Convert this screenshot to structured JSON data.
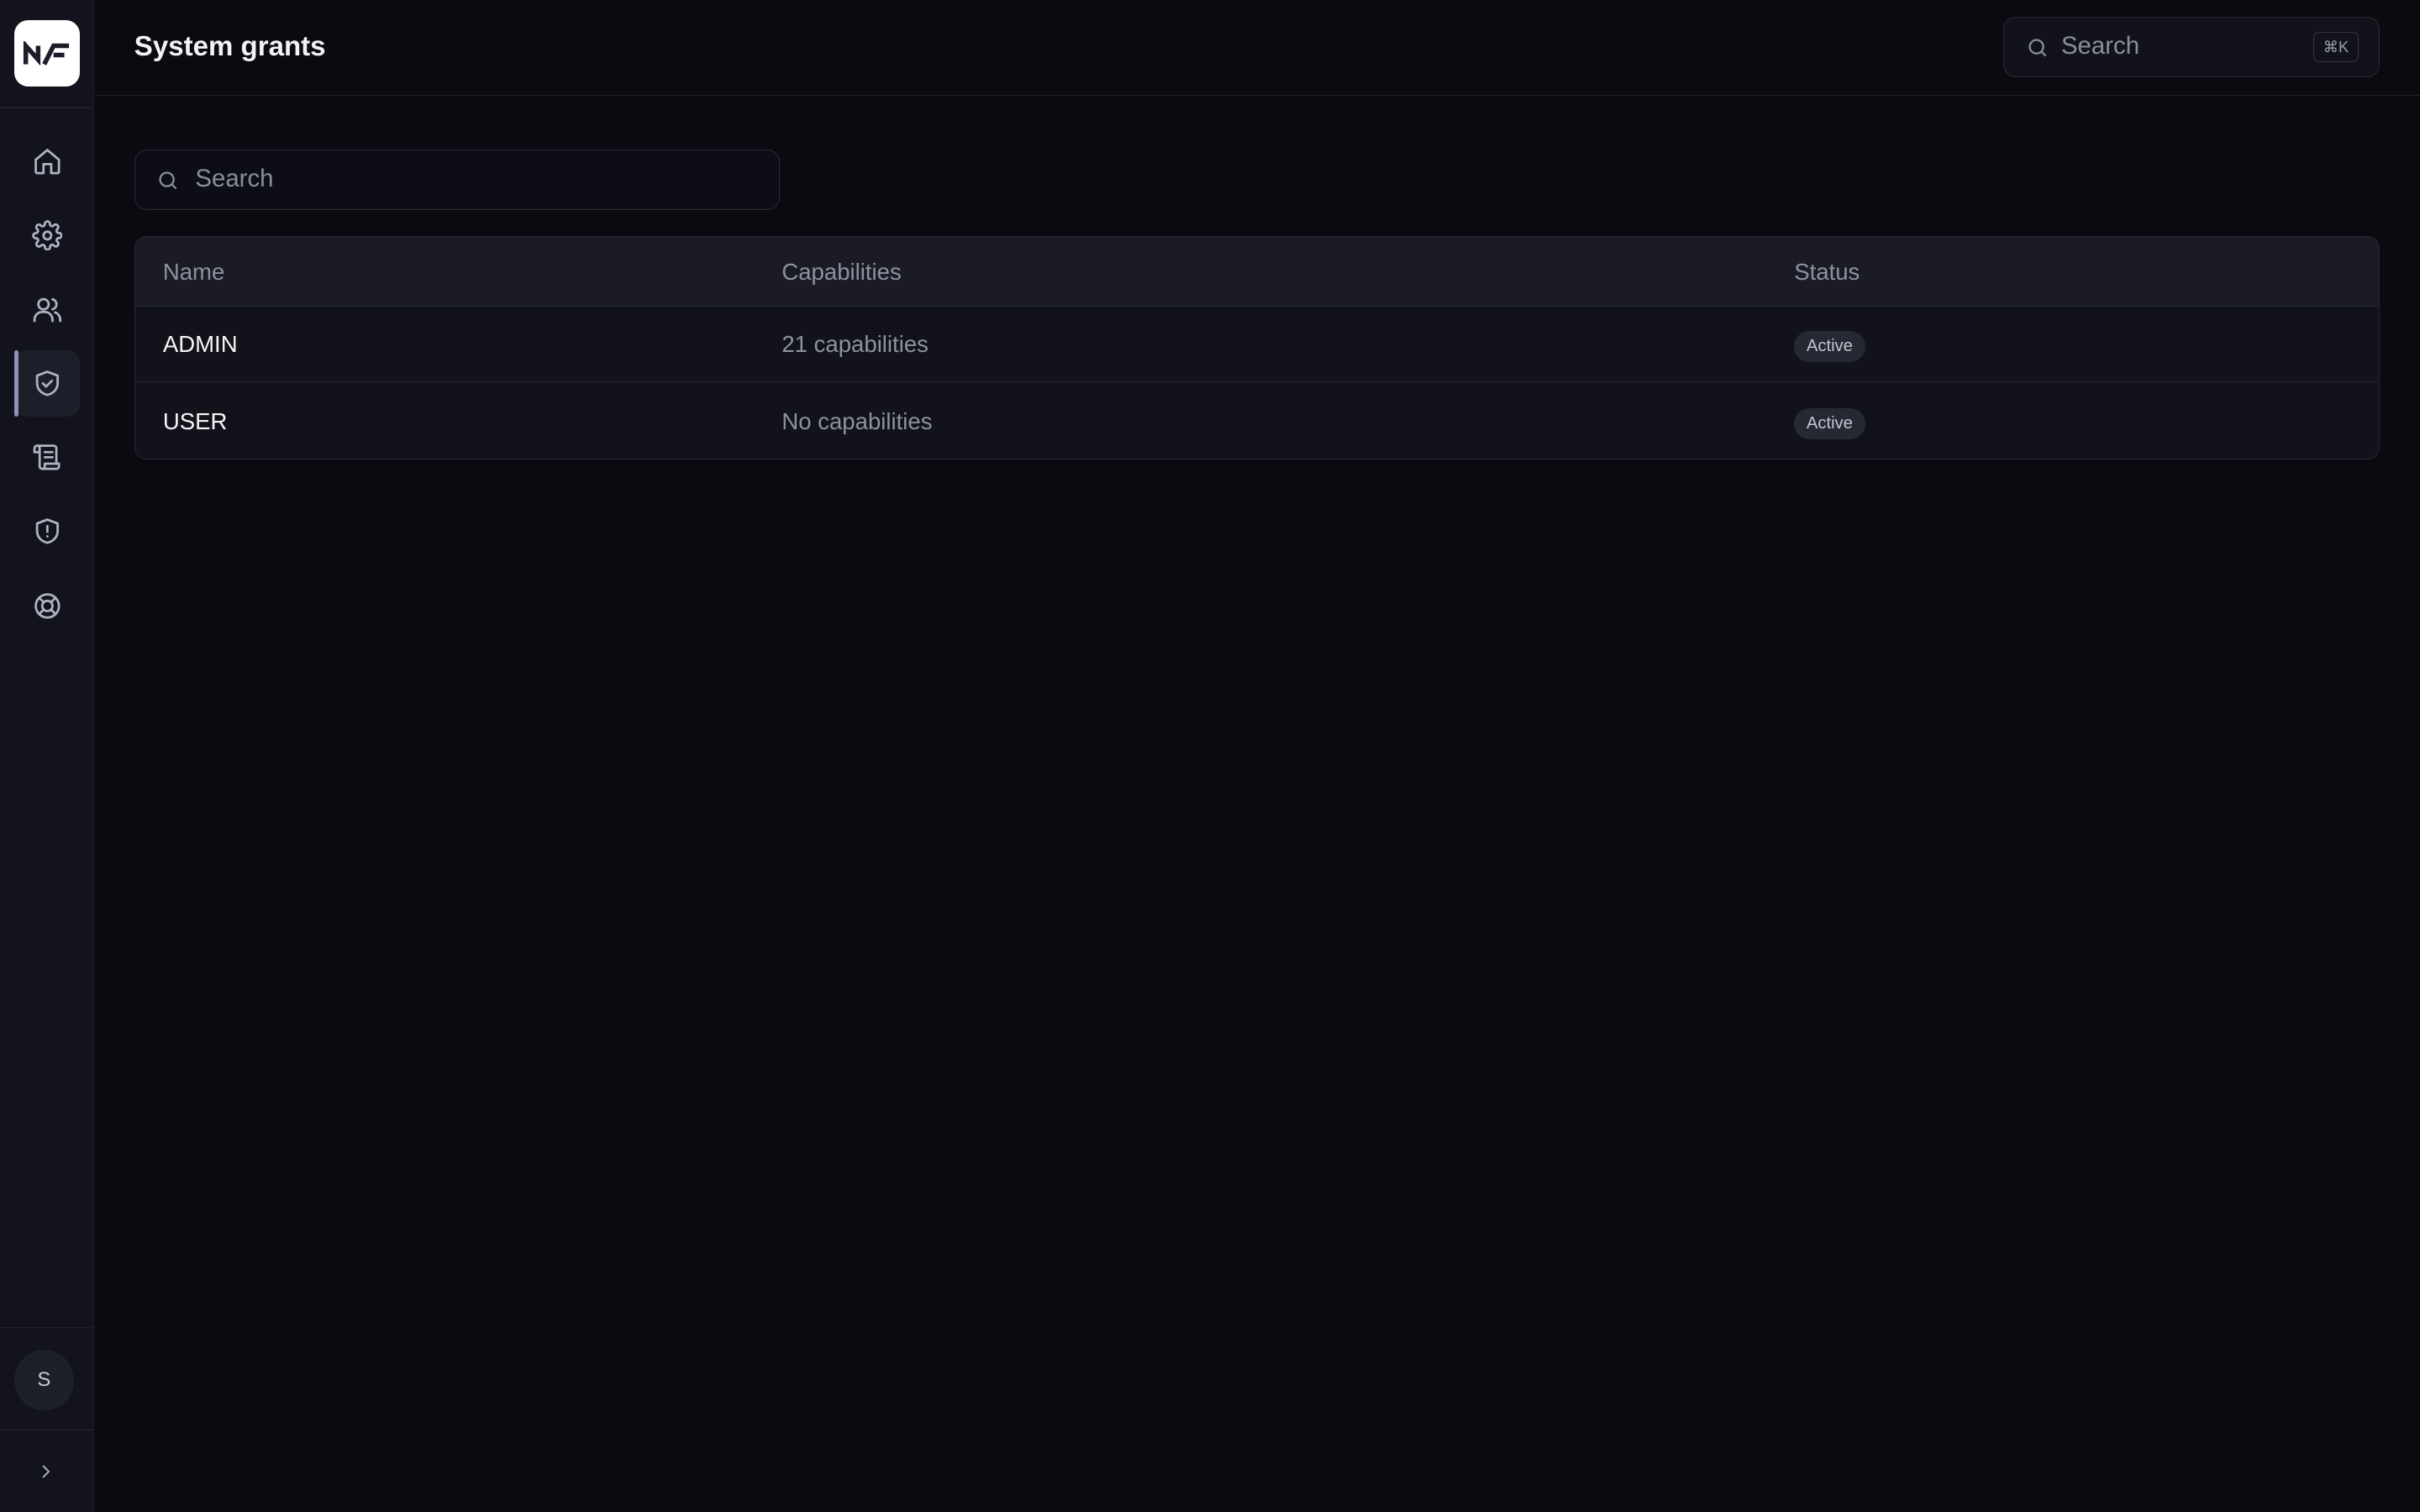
{
  "app": {
    "logo_text": "NF"
  },
  "sidebar": {
    "items": [
      {
        "name": "home",
        "icon": "home-icon"
      },
      {
        "name": "settings",
        "icon": "gear-icon"
      },
      {
        "name": "users",
        "icon": "users-icon"
      },
      {
        "name": "grants",
        "icon": "shield-check-icon",
        "active": true
      },
      {
        "name": "logs",
        "icon": "scroll-icon"
      },
      {
        "name": "alerts",
        "icon": "shield-alert-icon"
      },
      {
        "name": "support",
        "icon": "lifebuoy-icon"
      }
    ],
    "avatar_initial": "S",
    "expand_icon": "chevron-right-icon"
  },
  "header": {
    "title": "System grants",
    "search_placeholder": "Search",
    "shortcut": "⌘K"
  },
  "filter": {
    "placeholder": "Search"
  },
  "table": {
    "columns": {
      "name": "Name",
      "capabilities": "Capabilities",
      "status": "Status"
    },
    "rows": [
      {
        "name": "ADMIN",
        "capabilities": "21 capabilities",
        "status": "Active"
      },
      {
        "name": "USER",
        "capabilities": "No capabilities",
        "status": "Active"
      }
    ]
  }
}
